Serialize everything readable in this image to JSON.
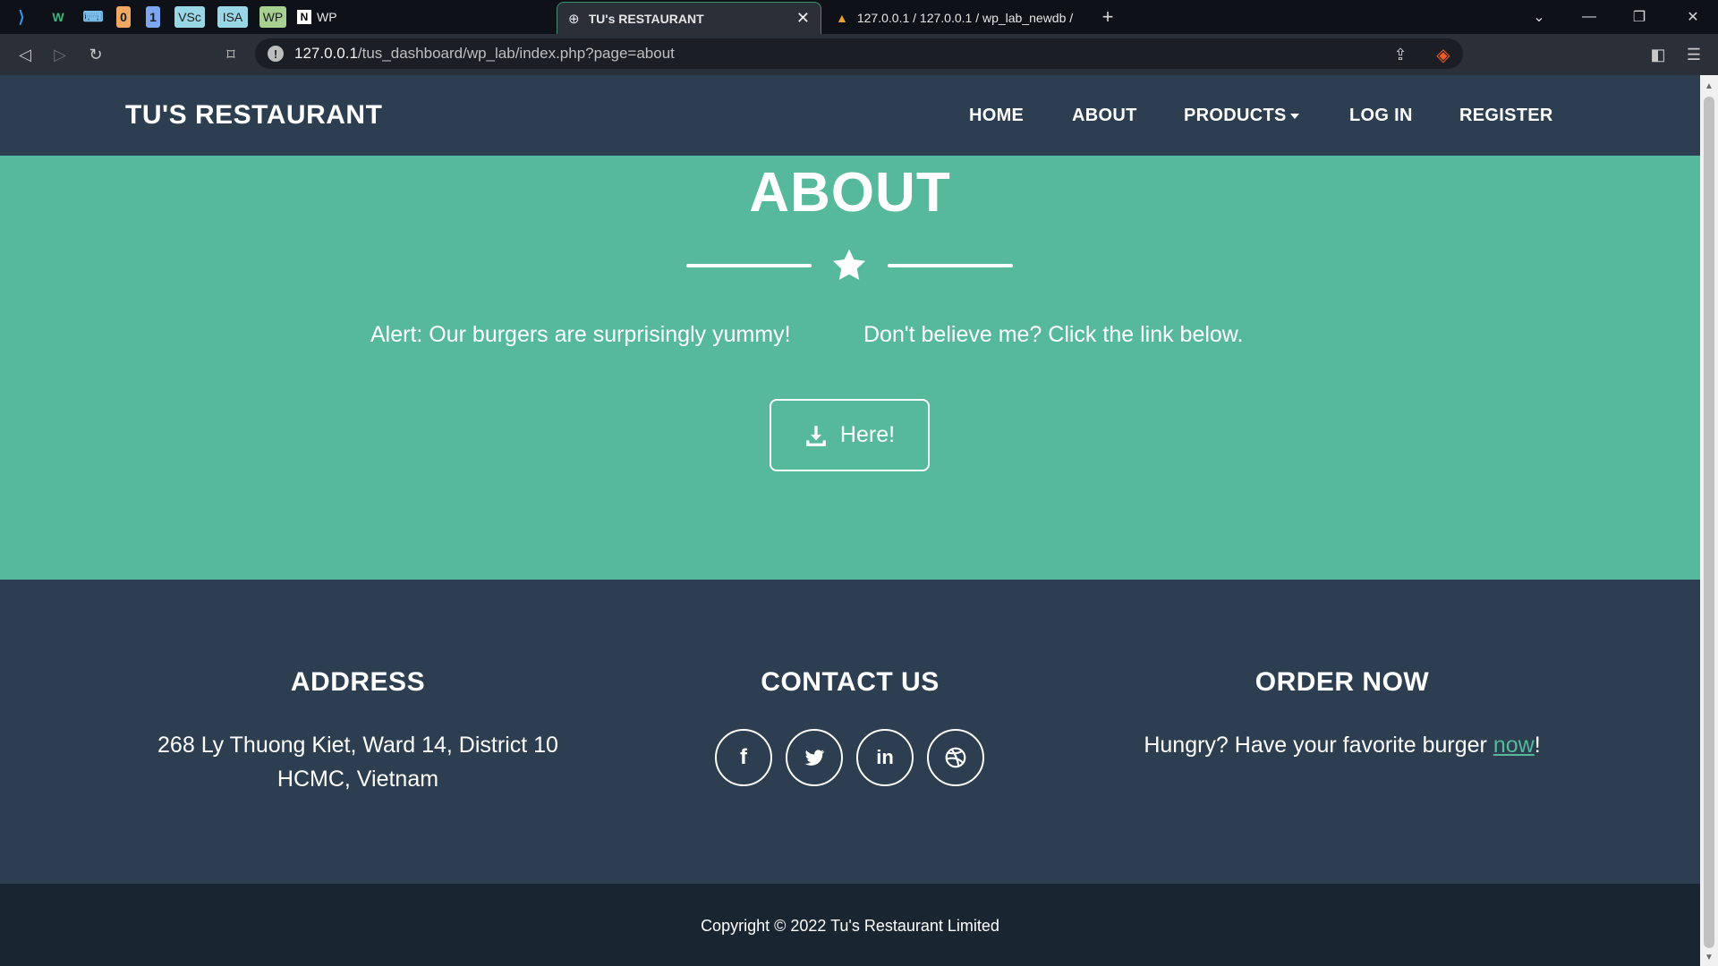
{
  "browser": {
    "pinned_tabs": [
      {
        "label": "",
        "icon": "vscode-icon",
        "color": "#0e1118"
      },
      {
        "label": "W",
        "icon": "w-icon",
        "color": "#0e1118"
      },
      {
        "label": "",
        "icon": "keyboard-icon",
        "color": "#0e1118"
      },
      {
        "label": "0",
        "color": "#f0a964"
      },
      {
        "label": "1",
        "color": "#7ca6f0"
      },
      {
        "label": "VSc",
        "color": "#9ad7e6"
      },
      {
        "label": "ISA",
        "color": "#9ad7e6"
      },
      {
        "label": "WP",
        "color": "#a6d08f"
      }
    ],
    "notion_tab_label": "WP",
    "tabs": [
      {
        "title": "TU's RESTAURANT",
        "active": true
      },
      {
        "title": "127.0.0.1 / 127.0.0.1 / wp_lab_newdb /",
        "active": false
      }
    ],
    "url_host": "127.0.0.1",
    "url_path": "/tus_dashboard/wp_lab/index.php?page=about"
  },
  "nav": {
    "brand": "TU'S RESTAURANT",
    "items": [
      "HOME",
      "ABOUT",
      "PRODUCTS",
      "LOG IN",
      "REGISTER"
    ]
  },
  "hero": {
    "title": "ABOUT",
    "text_left": "Alert: Our burgers are surprisingly yummy!",
    "text_right": "Don't believe me? Click the link below.",
    "button_label": "Here!"
  },
  "footer": {
    "address_heading": "ADDRESS",
    "address_line1": "268 Ly Thuong Kiet, Ward 14, District 10",
    "address_line2": "HCMC, Vietnam",
    "contact_heading": "CONTACT US",
    "social": [
      "facebook-icon",
      "twitter-icon",
      "linkedin-icon",
      "dribbble-icon"
    ],
    "order_heading": "ORDER NOW",
    "order_text": "Hungry? Have your favorite burger ",
    "order_link": "now",
    "order_suffix": "!"
  },
  "copyright": "Copyright © 2022 Tu's Restaurant Limited",
  "colors": {
    "navbar": "#2c3e50",
    "accent": "#56b99c",
    "copyright_bg": "#1a2532"
  }
}
